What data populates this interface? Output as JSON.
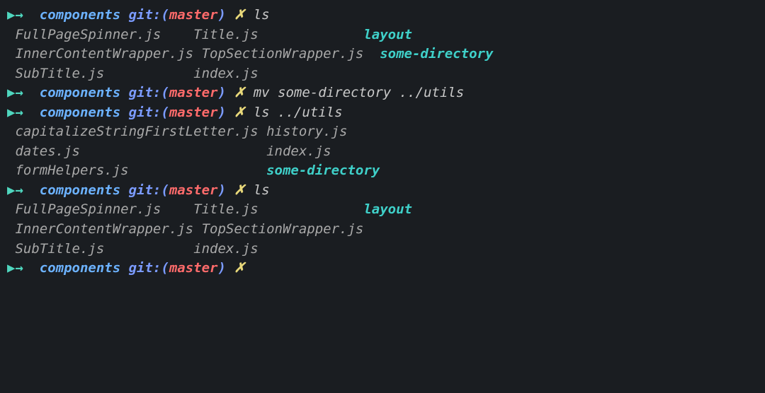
{
  "prompt": {
    "arrow": "▶→  ",
    "dir": "components",
    "git_label": "git:",
    "paren_open": "(",
    "branch": "master",
    "paren_close": ")",
    "x": " ✗ "
  },
  "blocks": [
    {
      "command": "ls",
      "output": [
        [
          {
            "text": "FullPageSpinner.js    ",
            "kind": "file"
          },
          {
            "text": "Title.js             ",
            "kind": "file"
          },
          {
            "text": "layout",
            "kind": "folder"
          }
        ],
        [
          {
            "text": "InnerContentWrapper.js ",
            "kind": "file"
          },
          {
            "text": "TopSectionWrapper.js  ",
            "kind": "file"
          },
          {
            "text": "some-directory",
            "kind": "folder"
          }
        ],
        [
          {
            "text": "SubTitle.js           ",
            "kind": "file"
          },
          {
            "text": "index.js",
            "kind": "file"
          }
        ]
      ]
    },
    {
      "command": "mv some-directory ../utils",
      "output": []
    },
    {
      "command": "ls ../utils",
      "output": [
        [
          {
            "text": "capitalizeStringFirstLetter.js ",
            "kind": "file"
          },
          {
            "text": "history.js",
            "kind": "file"
          }
        ],
        [
          {
            "text": "dates.js                       ",
            "kind": "file"
          },
          {
            "text": "index.js",
            "kind": "file"
          }
        ],
        [
          {
            "text": "formHelpers.js                 ",
            "kind": "file"
          },
          {
            "text": "some-directory",
            "kind": "folder"
          }
        ]
      ]
    },
    {
      "command": "ls",
      "output": [
        [
          {
            "text": "FullPageSpinner.js    ",
            "kind": "file"
          },
          {
            "text": "Title.js             ",
            "kind": "file"
          },
          {
            "text": "layout",
            "kind": "folder"
          }
        ],
        [
          {
            "text": "InnerContentWrapper.js ",
            "kind": "file"
          },
          {
            "text": "TopSectionWrapper.js",
            "kind": "file"
          }
        ],
        [
          {
            "text": "SubTitle.js           ",
            "kind": "file"
          },
          {
            "text": "index.js",
            "kind": "file"
          }
        ]
      ]
    },
    {
      "command": "",
      "output": []
    }
  ]
}
